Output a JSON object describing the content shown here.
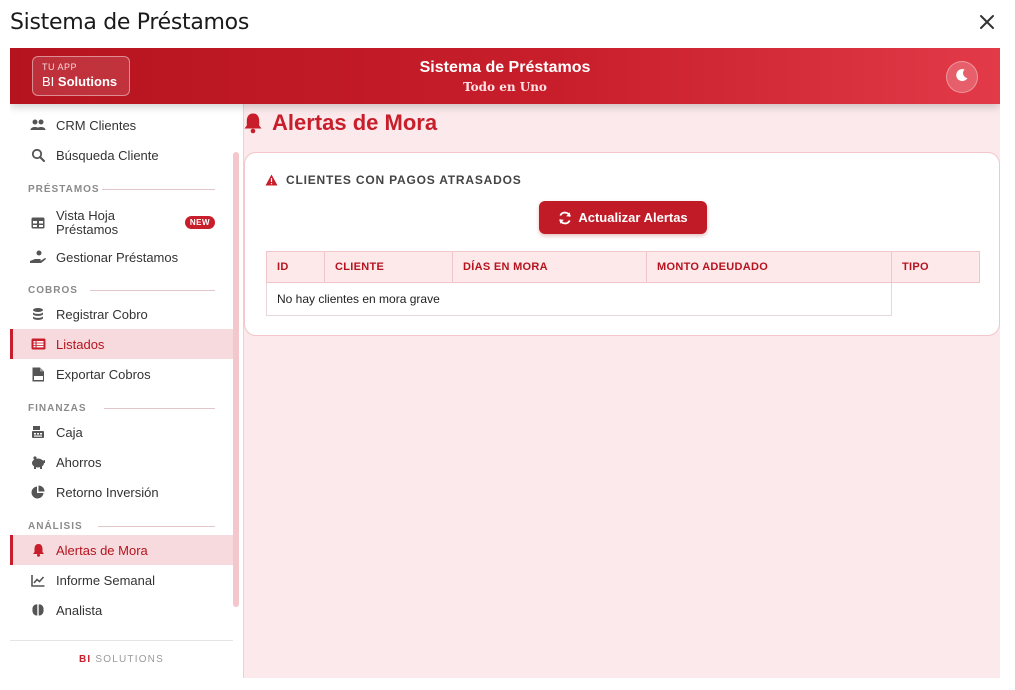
{
  "dialog": {
    "title": "Sistema de Préstamos"
  },
  "header": {
    "brand_small": "TU APP",
    "brand_prefix": "BI",
    "brand_name": "Solutions",
    "title": "Sistema de Préstamos",
    "subtitle": "Todo en Uno"
  },
  "sidebar": {
    "sections": {
      "prestamos": "PRÉSTAMOS",
      "cobros": "COBROS",
      "finanzas": "FINANZAS",
      "analisis": "ANÁLISIS"
    },
    "items": {
      "crm": "CRM Clientes",
      "busqueda": "Búsqueda Cliente",
      "vista_hoja_1": "Vista Hoja",
      "vista_hoja_2": "Préstamos",
      "vista_hoja_badge": "NEW",
      "gestionar": "Gestionar Préstamos",
      "registrar": "Registrar Cobro",
      "listados": "Listados",
      "exportar": "Exportar Cobros",
      "caja": "Caja",
      "ahorros": "Ahorros",
      "retorno": "Retorno Inversión",
      "alertas": "Alertas de Mora",
      "informe": "Informe Semanal",
      "analista": "Analista"
    },
    "footer_bold": "BI",
    "footer_rest": " SOLUTIONS"
  },
  "main": {
    "title": "Alertas de Mora",
    "card_title": "CLIENTES CON PAGOS ATRASADOS",
    "refresh_label": "Actualizar Alertas",
    "columns": [
      "ID",
      "CLIENTE",
      "DÍAS EN MORA",
      "MONTO ADEUDADO",
      "TIPO"
    ],
    "empty_message": "No hay clientes en mora grave"
  },
  "colors": {
    "accent": "#c81e2b",
    "active_bg": "#f6dadd",
    "page_bg": "#fbe9eb"
  }
}
